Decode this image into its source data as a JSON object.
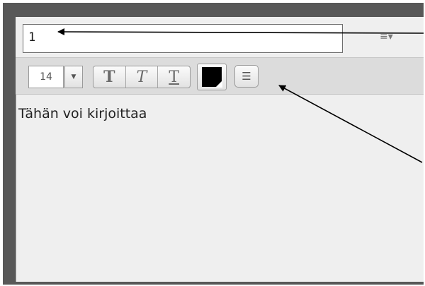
{
  "note": {
    "title_value": "1",
    "text": "Tähän voi kirjoittaa"
  },
  "toolbar": {
    "font_size": "14",
    "bold_label": "T",
    "italic_label": "T",
    "underline_label": "T",
    "text_color": "#000000"
  },
  "icons": {
    "menu": "≡▾",
    "dropdown": "▼",
    "list": "☰"
  }
}
